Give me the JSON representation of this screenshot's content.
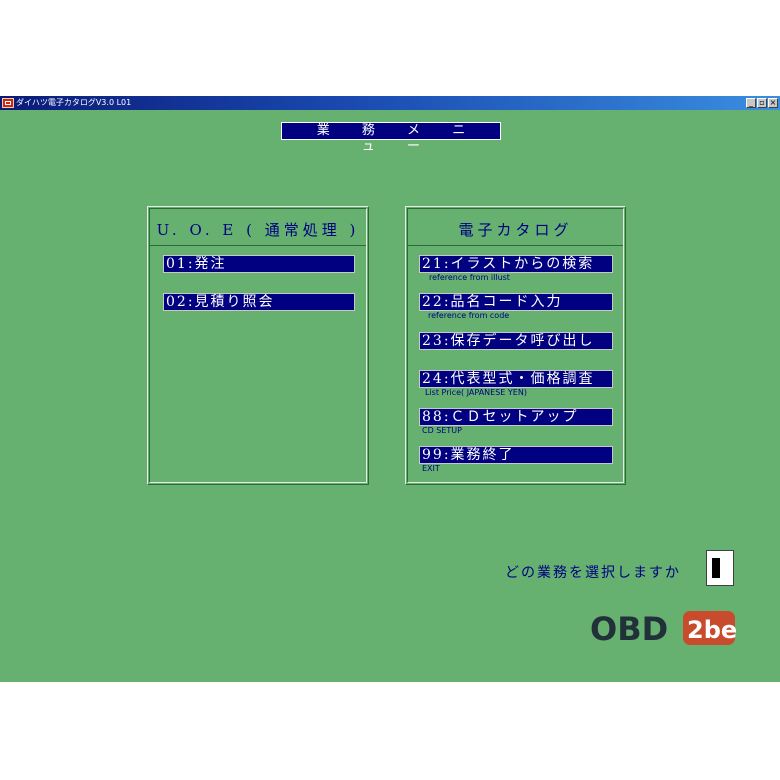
{
  "window": {
    "title": "ダイハツ電子カタログV3.0 L01",
    "controls": [
      "_",
      "▫",
      "×"
    ]
  },
  "menu_header": "業 務 メ ニ ュ ー",
  "uoe_panel": {
    "title": "U. O. E ( 通常処理 )",
    "items": [
      {
        "label": "01:発注"
      },
      {
        "label": "02:見積り照会"
      }
    ]
  },
  "catalog_panel": {
    "title": "電子カタログ",
    "items": [
      {
        "label": "21:イラストからの検索",
        "sub": "reference from illust"
      },
      {
        "label": "22:品名コード入力",
        "sub": "reference from code"
      },
      {
        "label": "23:保存データ呼び出し",
        "sub": ""
      },
      {
        "label": "24:代表型式・価格調査",
        "sub": "List Price( JAPANESE YEN)"
      },
      {
        "label": "88:ＣＤセットアップ",
        "sub": "CD SETUP"
      },
      {
        "label": "99:業務終了",
        "sub": "EXIT"
      }
    ]
  },
  "prompt": {
    "text": "どの業務を選択しますか",
    "input_value": ""
  },
  "logo": {
    "text_left": "OBD",
    "text_right": "2be",
    "colors": {
      "dark": "#22303a",
      "accent": "#c84b2e"
    }
  },
  "colors": {
    "background": "#66b070",
    "bar": "#000080",
    "text": "#000080"
  }
}
